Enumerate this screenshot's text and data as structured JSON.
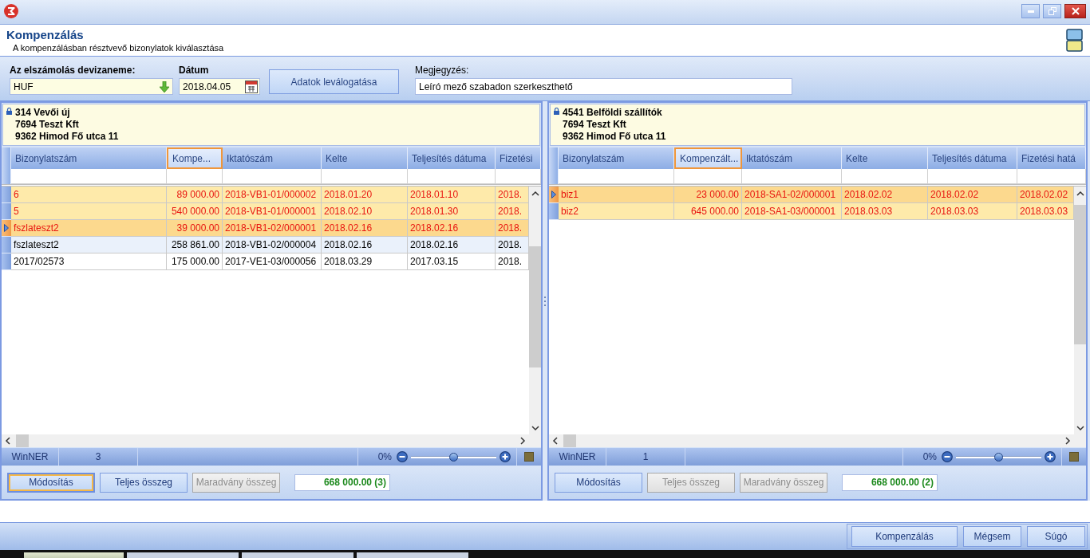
{
  "header": {
    "title": "Kompenzálás",
    "subtitle": "A kompenzálásban résztvevő bizonylatok kiválasztása"
  },
  "filters": {
    "currency": {
      "label": "Az elszámolás devizaneme:",
      "value": "HUF"
    },
    "date": {
      "label": "Dátum",
      "value": "2018.04.05"
    },
    "fetch_button": "Adatok leválogatása",
    "note": {
      "label": "Megjegyzés:",
      "value": "Leíró mező szabadon szerkeszthető"
    }
  },
  "panels": [
    {
      "info_lines": [
        "314 Vevői új",
        "7694 Teszt Kft",
        "9362 Himod Fő utca 11"
      ],
      "columns": [
        {
          "label": "Bizonylatszám",
          "focused": false
        },
        {
          "label": "Kompe...",
          "focused": true
        },
        {
          "label": "Iktatószám",
          "focused": false
        },
        {
          "label": "Kelte",
          "focused": false
        },
        {
          "label": "Teljesítés dátuma",
          "focused": false
        },
        {
          "label": "Fizetési",
          "focused": false
        }
      ],
      "rows": [
        {
          "cells": [
            "6",
            "89 000.00",
            "2018-VB1-01/000002",
            "2018.01.20",
            "2018.01.10",
            "2018."
          ],
          "selected": true,
          "current": false
        },
        {
          "cells": [
            "5",
            "540 000.00",
            "2018-VB1-01/000001",
            "2018.02.10",
            "2018.01.30",
            "2018."
          ],
          "selected": true,
          "current": false
        },
        {
          "cells": [
            "fszlateszt2",
            "39 000.00",
            "2018-VB1-02/000001",
            "2018.02.16",
            "2018.02.16",
            "2018."
          ],
          "selected": true,
          "current": true
        },
        {
          "cells": [
            "fszlateszt2",
            "258 861.00",
            "2018-VB1-02/000004",
            "2018.02.16",
            "2018.02.16",
            "2018."
          ],
          "selected": false,
          "current": false
        },
        {
          "cells": [
            "2017/02573",
            "175 000.00",
            "2017-VE1-03/000056",
            "2018.03.29",
            "2017.03.15",
            "2018."
          ],
          "selected": false,
          "current": false
        }
      ],
      "status": {
        "source": "WinNER",
        "count": "3",
        "zoom": {
          "reading": "0%",
          "level": 0.5
        }
      },
      "buttons": [
        {
          "label": "Módosítás",
          "disabled": false,
          "focused": true
        },
        {
          "label": "Teljes összeg",
          "disabled": false,
          "focused": false
        },
        {
          "label": "Maradvány összeg",
          "disabled": true,
          "focused": false
        }
      ],
      "total": "668 000.00 (3)"
    },
    {
      "info_lines": [
        "4541 Belföldi szállítók",
        "7694 Teszt Kft",
        "9362 Himod Fő utca 11"
      ],
      "columns": [
        {
          "label": "Bizonylatszám",
          "focused": false
        },
        {
          "label": "Kompenzált...",
          "focused": true
        },
        {
          "label": "Iktatószám",
          "focused": false
        },
        {
          "label": "Kelte",
          "focused": false
        },
        {
          "label": "Teljesítés dátuma",
          "focused": false
        },
        {
          "label": "Fizetési hatá",
          "focused": false
        }
      ],
      "rows": [
        {
          "cells": [
            "biz1",
            "23 000.00",
            "2018-SA1-02/000001",
            "2018.02.02",
            "2018.02.02",
            "2018.02.02"
          ],
          "selected": true,
          "current": true
        },
        {
          "cells": [
            "biz2",
            "645 000.00",
            "2018-SA1-03/000001",
            "2018.03.03",
            "2018.03.03",
            "2018.03.03"
          ],
          "selected": true,
          "current": false
        }
      ],
      "status": {
        "source": "WinNER",
        "count": "1",
        "zoom": {
          "reading": "0%",
          "level": 0.5
        }
      },
      "buttons": [
        {
          "label": "Módosítás",
          "disabled": false,
          "focused": false
        },
        {
          "label": "Teljes összeg",
          "disabled": true,
          "focused": false
        },
        {
          "label": "Maradvány összeg",
          "disabled": true,
          "focused": false
        }
      ],
      "total": "668 000.00 (2)"
    }
  ],
  "dialog_buttons": [
    {
      "label": "Kompenzálás"
    },
    {
      "label": "Mégsem"
    },
    {
      "label": "Súgó"
    }
  ]
}
